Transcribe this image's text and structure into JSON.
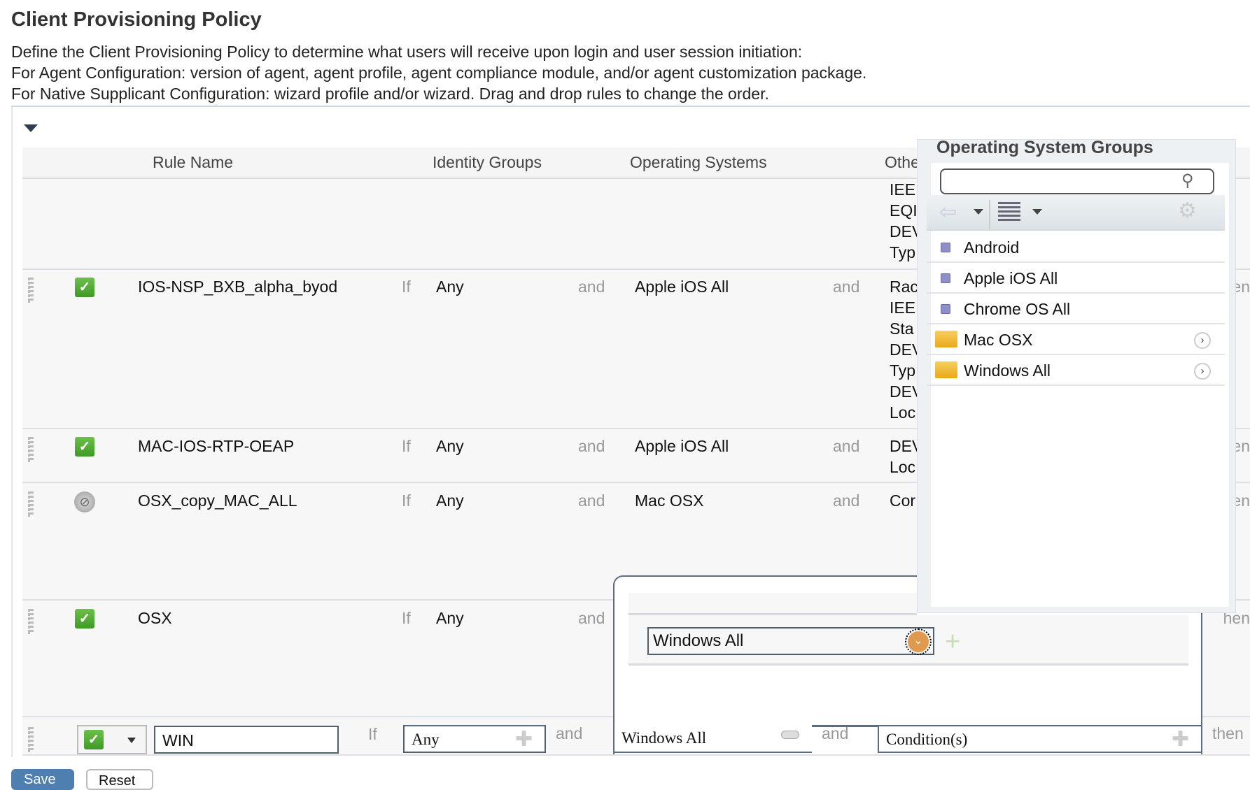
{
  "page": {
    "title": "Client Provisioning Policy",
    "description": [
      "Define the Client Provisioning Policy to determine what users will receive upon login and user session initiation:",
      "For Agent Configuration: version of agent, agent profile, agent compliance module, and/or agent customization package.",
      "For Native Supplicant Configuration: wizard profile and/or wizard. Drag and drop rules to change the order."
    ]
  },
  "table": {
    "headers": [
      "Rule Name",
      "Identity Groups",
      "Operating Systems",
      "Othe"
    ],
    "if_label": "If",
    "and_label": "and",
    "then_label": "then",
    "rows": [
      {
        "other": [
          "IEE",
          "EQI",
          "DEV",
          "Typ"
        ]
      },
      {
        "name": "IOS-NSP_BXB_alpha_byod",
        "status": "enabled",
        "identity": "Any",
        "os": "Apple iOS All",
        "other": [
          "Rac",
          "IEE",
          "Sta",
          "DEV",
          "Typ",
          "DEV",
          "Loc"
        ]
      },
      {
        "name": "MAC-IOS-RTP-OEAP",
        "status": "enabled",
        "identity": "Any",
        "os": "Apple iOS All",
        "other": [
          "DEV",
          "Loc"
        ]
      },
      {
        "name": "OSX_copy_MAC_ALL",
        "status": "disabled",
        "identity": "Any",
        "os": "Mac OSX",
        "other": [
          "Cor"
        ]
      },
      {
        "name": "OSX",
        "status": "enabled",
        "identity": "Any"
      }
    ],
    "edit_row": {
      "name": "WIN",
      "identity": "Any",
      "os": "Windows All",
      "conditions": "Condition(s)"
    }
  },
  "os_groups": {
    "title": "Operating System Groups",
    "search_placeholder": "",
    "items": [
      {
        "label": "Android",
        "type": "item"
      },
      {
        "label": "Apple iOS All",
        "type": "item"
      },
      {
        "label": "Chrome OS All",
        "type": "item"
      },
      {
        "label": "Mac OSX",
        "type": "folder"
      },
      {
        "label": "Windows All",
        "type": "folder"
      }
    ]
  },
  "condition_popup": {
    "selected": "Windows All"
  },
  "buttons": {
    "save": "Save",
    "reset": "Reset"
  },
  "colors": {
    "enabled": "#4caf2f",
    "accent": "#4f7fb0",
    "folder": "#f0b830"
  }
}
